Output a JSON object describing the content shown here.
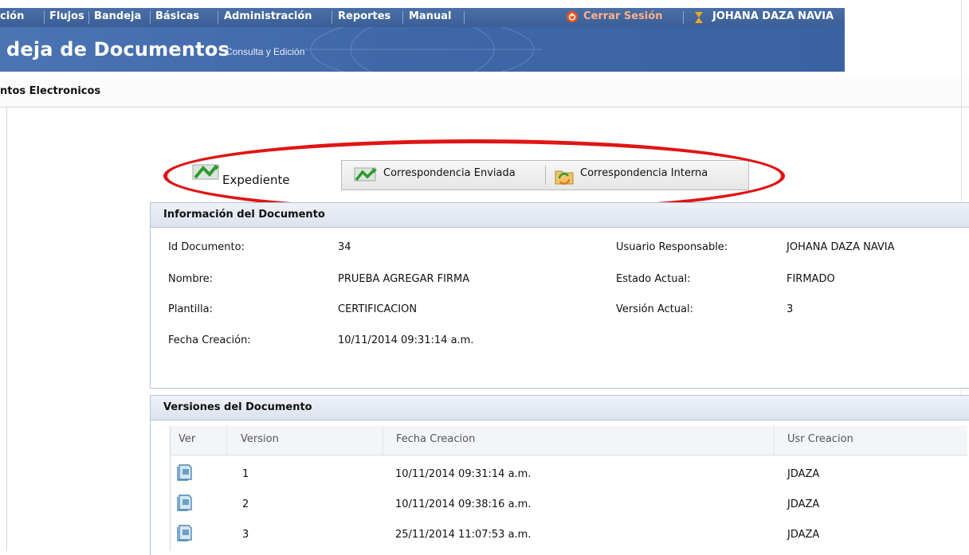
{
  "menu": {
    "items": [
      "ción",
      "Flujos",
      "Bandeja",
      "Básicas",
      "Administración",
      "Reportes",
      "Manual"
    ],
    "logout_label": "Cerrar Sesión",
    "user_name": "JOHANA DAZA NAVIA"
  },
  "banner": {
    "title": "deja de Documentos",
    "subtitle": "Consulta y Edición"
  },
  "tab": {
    "label": "ntos Electronicos"
  },
  "toolbar": {
    "expediente_label": "Expediente",
    "enviada_label": "Correspondencia Enviada",
    "interna_label": "Correspondencia Interna"
  },
  "info": {
    "title": "Información del Documento",
    "fields": [
      {
        "label": "Id Documento:",
        "value": "34"
      },
      {
        "label": "Nombre:",
        "value": "PRUEBA AGREGAR FIRMA"
      },
      {
        "label": "Plantilla:",
        "value": "CERTIFICACION"
      },
      {
        "label": "Fecha Creación:",
        "value": "10/11/2014 09:31:14 a.m."
      },
      {
        "label": "Usuario Responsable:",
        "value": "JOHANA DAZA NAVIA"
      },
      {
        "label": "Estado Actual:",
        "value": "FIRMADO"
      },
      {
        "label": "Versión Actual:",
        "value": "3"
      }
    ]
  },
  "versions": {
    "title": "Versiones del Documento",
    "columns": [
      "Ver",
      "Version",
      "Fecha Creacion",
      "Usr Creacion"
    ],
    "rows": [
      {
        "version": "1",
        "fecha": "10/11/2014 09:31:14 a.m.",
        "usuario": "JDAZA"
      },
      {
        "version": "2",
        "fecha": "10/11/2014 09:38:16 a.m.",
        "usuario": "JDAZA"
      },
      {
        "version": "3",
        "fecha": "25/11/2014 11:07:53 a.m.",
        "usuario": "JDAZA"
      }
    ]
  },
  "colors": {
    "accent": "#3f67a8",
    "highlight": "#e01515"
  }
}
